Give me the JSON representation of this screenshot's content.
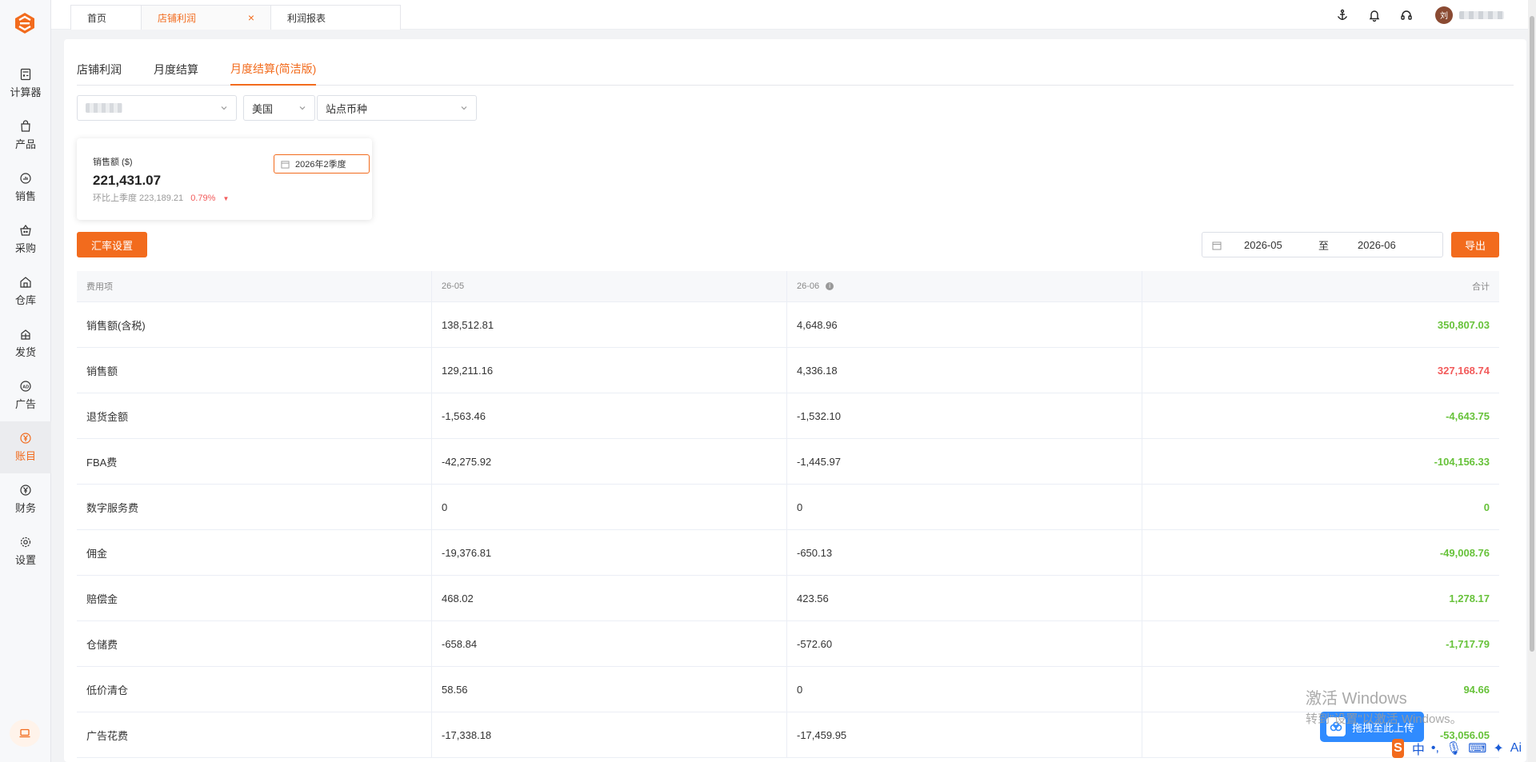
{
  "sidebar": {
    "items": [
      {
        "label": "计算器",
        "icon": "calculator-icon"
      },
      {
        "label": "产品",
        "icon": "bag-icon"
      },
      {
        "label": "销售",
        "icon": "chart-icon"
      },
      {
        "label": "采购",
        "icon": "basket-icon"
      },
      {
        "label": "仓库",
        "icon": "house-icon"
      },
      {
        "label": "发货",
        "icon": "truck-icon"
      },
      {
        "label": "广告",
        "icon": "ad-icon"
      },
      {
        "label": "账目",
        "icon": "yen-icon",
        "active": true
      },
      {
        "label": "财务",
        "icon": "yen-circle-icon"
      },
      {
        "label": "设置",
        "icon": "gear-icon"
      }
    ]
  },
  "topbar": {
    "tabs": [
      "首页",
      "店铺利润",
      "利润报表"
    ],
    "close_glyph": "×",
    "avatar_text": "刘"
  },
  "subtabs": [
    "店铺利润",
    "月度结算",
    "月度结算(简洁版)"
  ],
  "filters": {
    "country": "美国",
    "currency": "站点币种"
  },
  "kpi": {
    "label": "销售额 ($)",
    "value": "221,431.07",
    "compare_text": "环比上季度 223,189.21",
    "pct": "0.79%",
    "period": "2026年2季度"
  },
  "actions": {
    "rate_label": "汇率设置",
    "export_label": "导出",
    "range_start": "2026-05",
    "range_sep": "至",
    "range_end": "2026-06"
  },
  "table": {
    "headers": [
      "费用项",
      "26-05",
      "26-06",
      "合计"
    ],
    "rows": [
      [
        "销售额(含税)",
        "138,512.81",
        "4,648.96",
        "350,807.03"
      ],
      [
        "销售额",
        "129,211.16",
        "4,336.18",
        "327,168.74"
      ],
      [
        "退货金额",
        "-1,563.46",
        "-1,532.10",
        "-4,643.75"
      ],
      [
        "FBA费",
        "-42,275.92",
        "-1,445.97",
        "-104,156.33"
      ],
      [
        "数字服务费",
        "0",
        "0",
        "0"
      ],
      [
        "佣金",
        "-19,376.81",
        "-650.13",
        "-49,008.76"
      ],
      [
        "赔偿金",
        "468.02",
        "423.56",
        "1,278.17"
      ],
      [
        "仓储费",
        "-658.84",
        "-572.60",
        "-1,717.79"
      ],
      [
        "低价清仓",
        "58.56",
        "0",
        "94.66"
      ],
      [
        "广告花费",
        "-17,338.18",
        "-17,459.95",
        "-53,056.05"
      ]
    ]
  },
  "overlay": {
    "upload_label": "拖拽至此上传",
    "watermark_1": "激活 Windows",
    "watermark_2": "转到\"设置\"以激活 Windows。",
    "ime_logo": "S",
    "ime_lang": "中",
    "ime_ai": "Ai"
  },
  "colors": {
    "accent": "#f26b1d",
    "positive": "#67c23a",
    "negative": "#f25a5a"
  }
}
